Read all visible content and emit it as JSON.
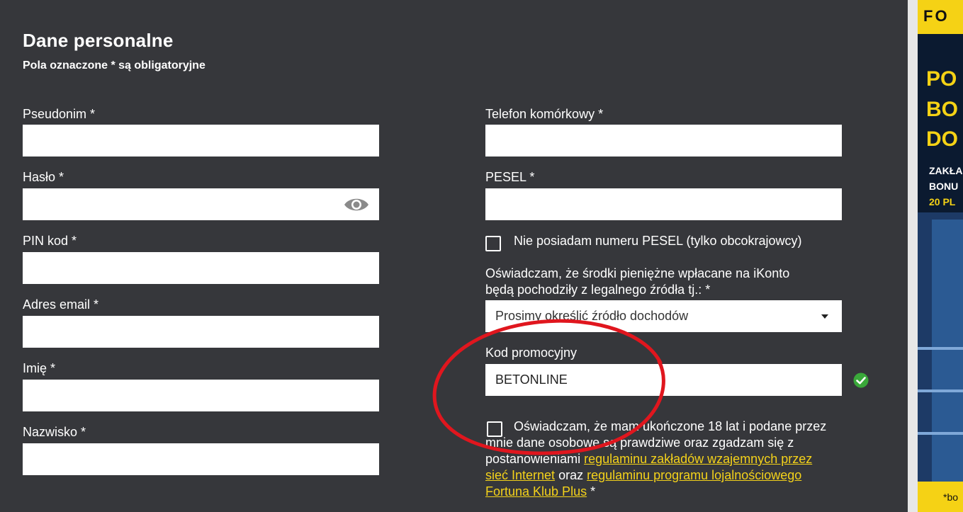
{
  "header": {
    "title": "Dane personalne",
    "subtitle": "Pola oznaczone * są obligatoryjne"
  },
  "left_fields": [
    {
      "label": "Pseudonim *",
      "value": ""
    },
    {
      "label": "Hasło *",
      "value": ""
    },
    {
      "label": "PIN kod *",
      "value": ""
    },
    {
      "label": "Adres email *",
      "value": ""
    },
    {
      "label": "Imię *",
      "value": ""
    },
    {
      "label": "Nazwisko *",
      "value": ""
    }
  ],
  "right_fields": {
    "phone_label": "Telefon komórkowy *",
    "phone_value": "",
    "pesel_label": "PESEL *",
    "pesel_value": "",
    "no_pesel_checkbox": "Nie posiadam numeru PESEL (tylko obcokrajowcy)",
    "source_statement": "Oświadczam, że środki pieniężne wpłacane na iKonto będą pochodziły z legalnego źródła tj.: *",
    "source_select": "Prosimy określić źródło dochodów",
    "promo_label": "Kod promocyjny",
    "promo_value": "BETONLINE",
    "age_text_1": "Oświadczam, że mam ukończone 18 lat i podane przez mnie dane osobowe są prawdziwe oraz zgadzam się z postanowieniami ",
    "age_link_1": "regulaminu zakładów wzajemnych przez sieć Internet",
    "age_text_2": " oraz ",
    "age_link_2": "regulaminu programu lojalnościowego Fortuna Klub Plus",
    "age_text_3": " *"
  },
  "ad": {
    "brand": "FO",
    "headline": [
      "PO",
      "BO",
      "DO"
    ],
    "lines": [
      "ZAKŁA",
      "BONU",
      "20 PL"
    ],
    "footnote": "*bo"
  },
  "colors": {
    "background": "#36373b",
    "link": "#f4d21a",
    "valid": "#3aa83a",
    "annotation": "#e0161e",
    "ad_yellow": "#f5d215"
  },
  "icons": {
    "password_toggle": "eye-icon",
    "promo_valid": "check-circle-icon",
    "select_caret": "caret-down-icon"
  }
}
